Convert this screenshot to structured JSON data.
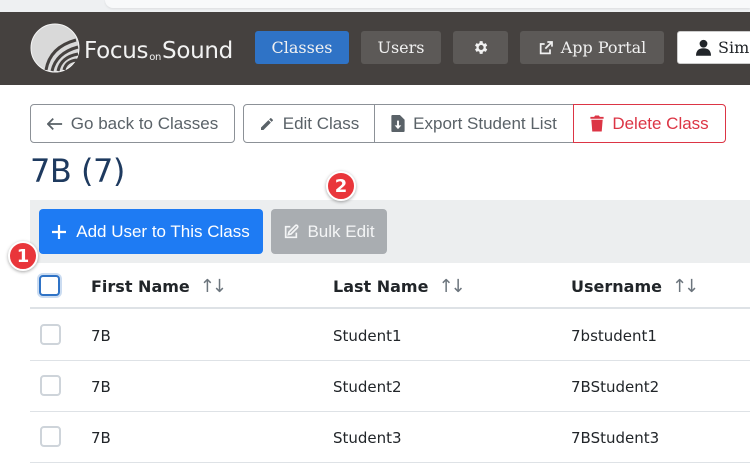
{
  "navbar": {
    "brand": {
      "main": "Focus",
      "small": "on",
      "end": "Sound"
    },
    "classes_label": "Classes",
    "users_label": "Users",
    "app_portal_label": "App Portal",
    "user_label": "Sim"
  },
  "toolbar": {
    "back_label": "Go back to Classes",
    "edit_label": "Edit Class",
    "export_label": "Export Student List",
    "delete_label": "Delete Class"
  },
  "page": {
    "title": "7B (7)"
  },
  "actions": {
    "add_user_label": "Add User to This Class",
    "bulk_edit_label": "Bulk Edit"
  },
  "table": {
    "columns": [
      "First Name",
      "Last Name",
      "Username"
    ],
    "rows": [
      {
        "first": "7B",
        "last": "Student1",
        "username": "7bstudent1"
      },
      {
        "first": "7B",
        "last": "Student2",
        "username": "7BStudent2"
      },
      {
        "first": "7B",
        "last": "Student3",
        "username": "7BStudent3"
      }
    ]
  },
  "annotations": {
    "one": "1",
    "two": "2"
  },
  "colors": {
    "navbar": "#45413f",
    "primary": "#1e7bf3",
    "danger": "#dc3545",
    "badge": "#e9363b"
  }
}
